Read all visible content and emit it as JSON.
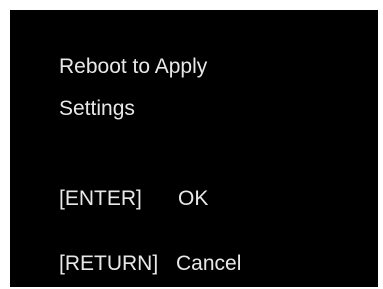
{
  "dialog": {
    "message_line1": "Reboot to Apply",
    "message_line2": "Settings",
    "options": [
      {
        "key": "[ENTER]",
        "action": "OK"
      },
      {
        "key": "[RETURN]",
        "action": "Cancel"
      }
    ]
  },
  "colors": {
    "background": "#000000",
    "text": "#e8e8e8",
    "border": "#ffffff"
  }
}
